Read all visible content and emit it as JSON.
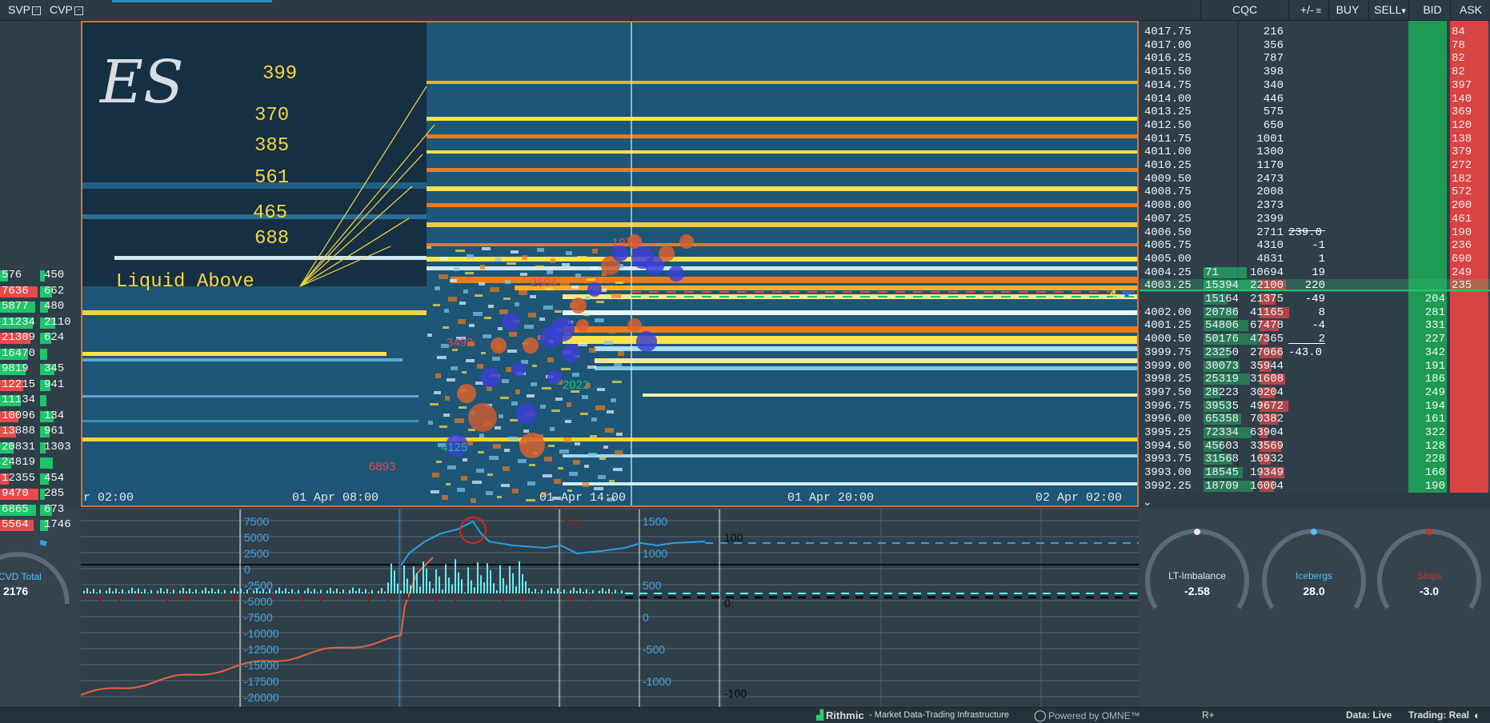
{
  "topbar": {
    "svp": "SVP",
    "cvp": "CVP",
    "columns": [
      "CQC",
      "+/-",
      "BUY",
      "SELL",
      "BID",
      "ASK"
    ]
  },
  "heatmap": {
    "symbol_sketch": "ES",
    "liquid_label": "Liquid Above",
    "annotations": [
      "399",
      "370",
      "385",
      "561",
      "465",
      "688"
    ],
    "bubble_labels": [
      "3493",
      "4125",
      "6893",
      "2504",
      "1978",
      "2022"
    ],
    "time_axis": [
      "r 02:00",
      "01 Apr 08:00",
      "01 Apr 14:00",
      "01 Apr 20:00",
      "02 Apr 02:00"
    ],
    "current_price_marker": "4"
  },
  "left_profile": [
    {
      "a": "576",
      "b": "450"
    },
    {
      "a": "7636",
      "b": "662"
    },
    {
      "a": "5877",
      "b": "480"
    },
    {
      "a": "11234",
      "b": "2110"
    },
    {
      "a": "21309",
      "b": "624"
    },
    {
      "a": "16470",
      "b": ""
    },
    {
      "a": "9819",
      "b": "345"
    },
    {
      "a": "12215",
      "b": "941"
    },
    {
      "a": "11134",
      "b": ""
    },
    {
      "a": "10096",
      "b": "134"
    },
    {
      "a": "13888",
      "b": "961"
    },
    {
      "a": "20831",
      "b": "1303"
    },
    {
      "a": "24819",
      "b": ""
    },
    {
      "a": "12355",
      "b": "454"
    },
    {
      "a": "9470",
      "b": "285"
    },
    {
      "a": "6865",
      "b": "673"
    },
    {
      "a": "5564",
      "b": "1746"
    }
  ],
  "dom": {
    "rows": [
      {
        "price": "4017.75",
        "cqc": "216",
        "ask": "84"
      },
      {
        "price": "4017.00",
        "cqc": "356",
        "ask": "78"
      },
      {
        "price": "4016.25",
        "cqc": "787",
        "ask": "82"
      },
      {
        "price": "4015.50",
        "cqc": "398",
        "ask": "82"
      },
      {
        "price": "4014.75",
        "cqc": "340",
        "ask": "397"
      },
      {
        "price": "4014.00",
        "cqc": "446",
        "ask": "140"
      },
      {
        "price": "4013.25",
        "cqc": "575",
        "ask": "369"
      },
      {
        "price": "4012.50",
        "cqc": "650",
        "ask": "120"
      },
      {
        "price": "4011.75",
        "cqc": "1001",
        "ask": "138"
      },
      {
        "price": "4011.00",
        "cqc": "1300",
        "ask": "379"
      },
      {
        "price": "4010.25",
        "cqc": "1170",
        "ask": "272"
      },
      {
        "price": "4009.50",
        "cqc": "2473",
        "ask": "182"
      },
      {
        "price": "4008.75",
        "cqc": "2008",
        "ask": "572"
      },
      {
        "price": "4008.00",
        "cqc": "2373",
        "ask": "200"
      },
      {
        "price": "4007.25",
        "cqc": "2399",
        "ask": "461"
      },
      {
        "price": "4006.50",
        "cqc": "2711",
        "ask": "190",
        "delta": "239.0"
      },
      {
        "price": "4005.75",
        "cqc": "4310",
        "ask": "236",
        "delta": "-1"
      },
      {
        "price": "4005.00",
        "cqc": "4831",
        "ask": "690",
        "delta": "1"
      },
      {
        "price": "4004.25",
        "vol": "71",
        "cqc": "10694",
        "ask": "249",
        "delta": "19"
      },
      {
        "price": "4003.25",
        "vol": "15394",
        "cqc": "22100",
        "ask": "235",
        "delta": "220"
      },
      {
        "price": "",
        "vol": "15164",
        "cqc": "21375",
        "bid": "204",
        "delta": "-49"
      },
      {
        "price": "4002.00",
        "vol": "20786",
        "cqc": "41165",
        "bid": "281",
        "delta": "8"
      },
      {
        "price": "4001.25",
        "vol": "54806",
        "cqc": "67478",
        "bid": "331",
        "delta": "-4"
      },
      {
        "price": "4000.50",
        "vol": "50176",
        "cqc": "47365",
        "bid": "227",
        "delta": "2"
      },
      {
        "price": "3999.75",
        "vol": "23250",
        "cqc": "27066",
        "bid": "342",
        "delta": "-43.0"
      },
      {
        "price": "3999.00",
        "vol": "30073",
        "cqc": "35944",
        "bid": "191"
      },
      {
        "price": "3998.25",
        "vol": "25319",
        "cqc": "31608",
        "bid": "186"
      },
      {
        "price": "3997.50",
        "vol": "28223",
        "cqc": "30204",
        "bid": "249"
      },
      {
        "price": "3996.75",
        "vol": "39535",
        "cqc": "49672",
        "bid": "194"
      },
      {
        "price": "3996.00",
        "vol": "65358",
        "cqc": "70382",
        "bid": "161"
      },
      {
        "price": "3995.25",
        "vol": "72334",
        "cqc": "63904",
        "bid": "322"
      },
      {
        "price": "3994.50",
        "vol": "45603",
        "cqc": "33569",
        "bid": "128"
      },
      {
        "price": "3993.75",
        "vol": "31568",
        "cqc": "16932",
        "bid": "228"
      },
      {
        "price": "3993.00",
        "vol": "18545",
        "cqc": "19349",
        "bid": "160"
      },
      {
        "price": "3992.25",
        "vol": "18709",
        "cqc": "16004",
        "bid": "190"
      }
    ]
  },
  "cvd": {
    "total_label": "CVD Total",
    "total_value": "2176",
    "left_axis": [
      "7500",
      "5000",
      "2500",
      "0",
      "-2500",
      "-5000",
      "-7500",
      "-10000",
      "-12500",
      "-15000",
      "-17500",
      "-20000"
    ],
    "right_axis": [
      "1500",
      "1000",
      "500",
      "0",
      "-500",
      "-1000"
    ],
    "far_axis": [
      "100",
      "0",
      "-100"
    ],
    "marker": "500"
  },
  "gauges": [
    {
      "label": "LT-Imbalance",
      "value": "-2.58",
      "color": "#e6e6e6"
    },
    {
      "label": "Icebergs",
      "value": "28.0",
      "color": "#4fc3f7"
    },
    {
      "label": "Stops",
      "value": "-3.0",
      "color": "#c0392b"
    }
  ],
  "status": {
    "brand": "Rithmic",
    "tagline": "- Market Data-Trading Infrastructure",
    "powered": "Powered by OMNE™",
    "rplus": "R+",
    "data": "Data: Live",
    "trading": "Trading: Real"
  }
}
